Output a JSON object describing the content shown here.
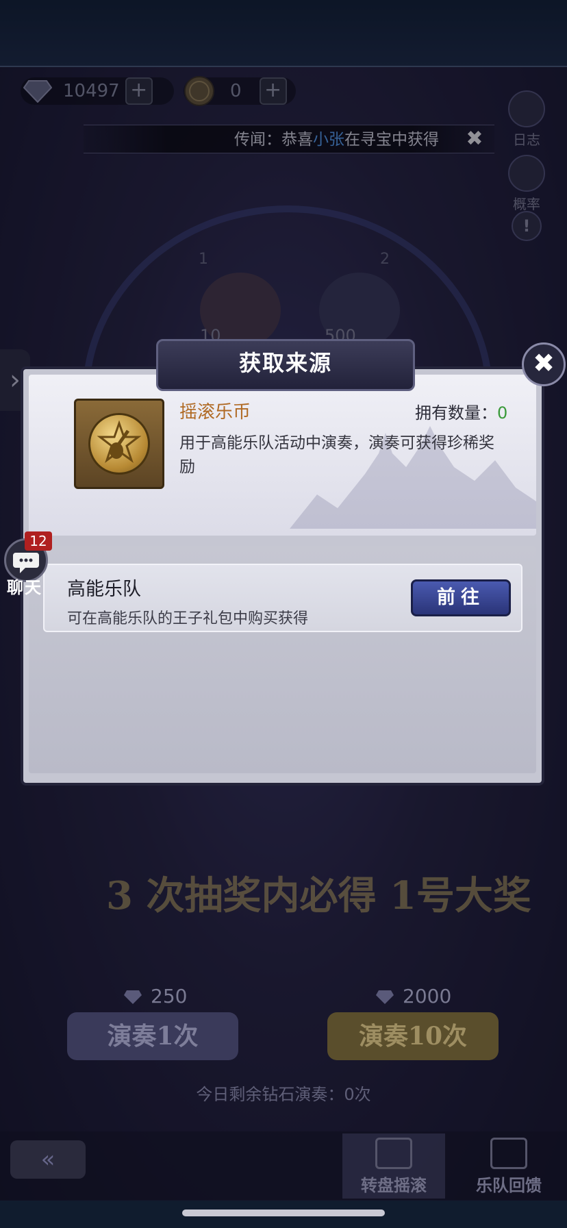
{
  "currency": {
    "diamonds": "10497",
    "coins": "0"
  },
  "ticker": {
    "prefix": "传闻：恭喜",
    "name": "小张",
    "suffix": "在寻宝中获得"
  },
  "side": {
    "log": "日志",
    "prob": "概率"
  },
  "wheel": {
    "slot1_index": "1",
    "slot1_count": "10",
    "slot2_index": "2",
    "slot2_count": "500"
  },
  "modal": {
    "title": "获取来源",
    "item_name": "摇滚乐币",
    "owned_label": "拥有数量：",
    "owned_value": "0",
    "item_desc": "用于高能乐队活动中演奏，演奏可获得珍稀奖励",
    "source_title": "高能乐队",
    "source_desc": "可在高能乐队的王子礼包中购买获得",
    "go_button": "前往"
  },
  "chat": {
    "badge": "12",
    "label": "聊天"
  },
  "banner": "3 次抽奖内必得 1号大奖",
  "play": {
    "price1": "250",
    "price10": "2000",
    "btn1": "演奏1次",
    "btn10": "演奏10次",
    "remaining": "今日剩余钻石演奏：0次"
  },
  "nav": {
    "tab1": "转盘摇滚",
    "tab2": "乐队回馈"
  },
  "colors": {
    "item_name": "#b06a24",
    "owned_value": "#3a9a3a",
    "ticker_highlight": "#5aa8ff",
    "go_button": "#3a46a0"
  }
}
